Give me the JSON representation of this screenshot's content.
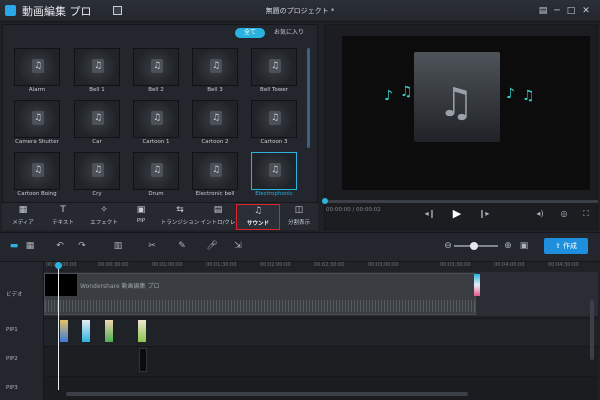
{
  "app": {
    "title": "動画編集 プロ",
    "project_title": "無題のプロジェクト *"
  },
  "window_controls": [
    "▤",
    "─",
    "□",
    "✕"
  ],
  "library": {
    "filters": {
      "all": "全て",
      "favorites": "お気に入り"
    },
    "items": [
      {
        "label": "Alarm"
      },
      {
        "label": "Bell 1"
      },
      {
        "label": "Bell 2"
      },
      {
        "label": "Bell 3"
      },
      {
        "label": "Bell Tower"
      },
      {
        "label": "Camera Shutter"
      },
      {
        "label": "Car"
      },
      {
        "label": "Cartoon 1"
      },
      {
        "label": "Cartoon 2"
      },
      {
        "label": "Cartoon 3"
      },
      {
        "label": "Cartoon Boing"
      },
      {
        "label": "Cry"
      },
      {
        "label": "Drum"
      },
      {
        "label": "Electronic bell"
      },
      {
        "label": "Electrophonic"
      }
    ],
    "selected_item": "Electrophonic"
  },
  "toolbar": {
    "media": "メディア",
    "text": "テキスト",
    "effect": "エフェクト",
    "pip": "PIP",
    "transition": "トランジション",
    "intro": "イントロ/クレ",
    "sound": "サウンド",
    "split": "分割表示"
  },
  "preview": {
    "time": "00:00:00 / 00:00:02"
  },
  "timeline": {
    "create_label": "作成",
    "ruler": [
      "00:00:00:00",
      "00:00:30:00",
      "00:01:00:00",
      "00:01:30:00",
      "00:02:00:00",
      "00:02:30:00",
      "00:03:00:00",
      "00:03:30:00",
      "00:04:00:00",
      "00:04:30:00"
    ],
    "tracks": {
      "video": "ビデオ",
      "pip1": "PIP1",
      "pip2": "PIP2",
      "pip3": "PIP3"
    },
    "video_clip_label": "Wondershare 動画編集 プロ"
  },
  "colors": {
    "accent": "#2bb3e0",
    "create_button": "#1e8fdc",
    "highlight_box": "#e0222c"
  }
}
